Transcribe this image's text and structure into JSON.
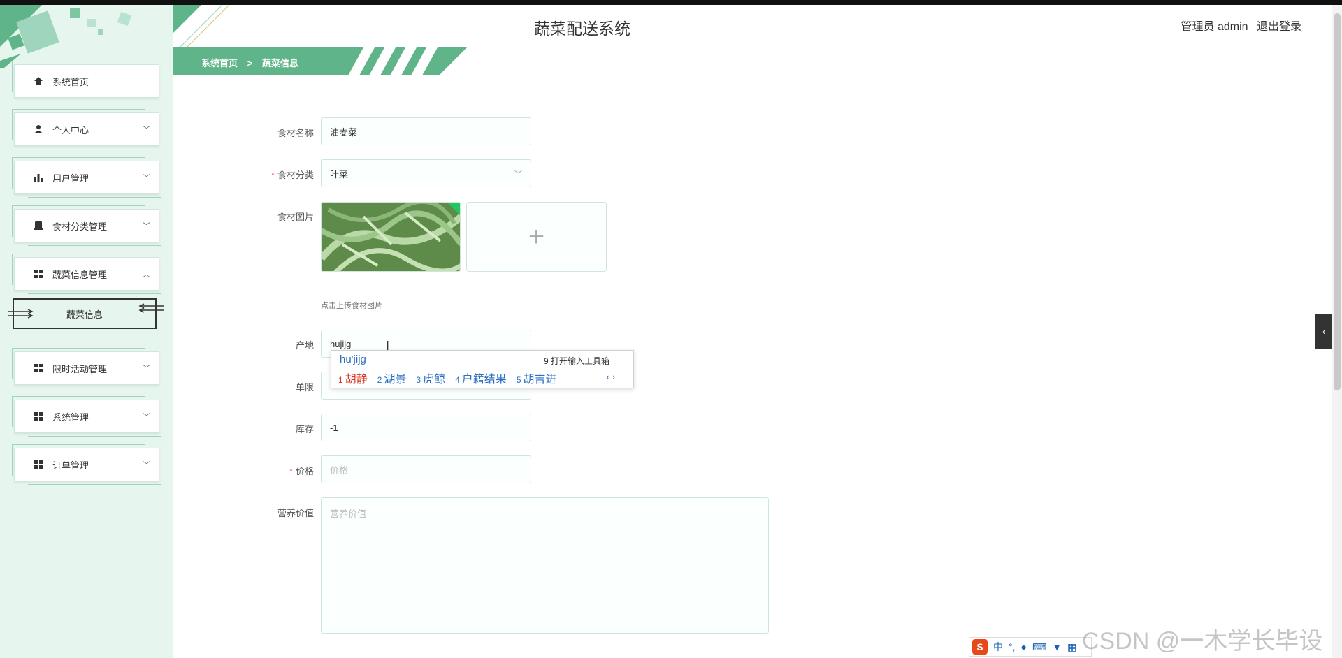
{
  "app": {
    "title": "蔬菜配送系统",
    "user_label": "管理员 admin",
    "logout": "退出登录"
  },
  "breadcrumb": {
    "home": "系统首页",
    "separator": ">",
    "current": "蔬菜信息"
  },
  "sidebar": {
    "items": [
      {
        "label": "系统首页",
        "icon": "home-icon"
      },
      {
        "label": "个人中心",
        "icon": "user-icon"
      },
      {
        "label": "用户管理",
        "icon": "bar-chart-icon"
      },
      {
        "label": "食材分类管理",
        "icon": "category-icon"
      },
      {
        "label": "蔬菜信息管理",
        "icon": "grid-icon"
      },
      {
        "label": "限时活动管理",
        "icon": "grid-icon"
      },
      {
        "label": "系统管理",
        "icon": "grid-icon"
      },
      {
        "label": "订单管理",
        "icon": "grid-icon"
      }
    ],
    "submenu": {
      "label": "蔬菜信息"
    }
  },
  "form": {
    "name": {
      "label": "食材名称",
      "value": "油麦菜"
    },
    "category": {
      "label": "食材分类",
      "value": "叶菜"
    },
    "image": {
      "label": "食材图片",
      "upload_tip": "点击上传食材图片",
      "plus": "+"
    },
    "origin": {
      "label": "产地",
      "value": "hujijg"
    },
    "limit": {
      "label": "单限",
      "value": ""
    },
    "stock": {
      "label": "库存",
      "value": "-1"
    },
    "price": {
      "label": "价格",
      "placeholder": "价格"
    },
    "nutrition": {
      "label": "营养价值",
      "placeholder": "营养价值"
    },
    "required_mark": "*"
  },
  "ime": {
    "composition": "hu'jijg",
    "tools": "9 打开输入工具箱",
    "candidates": [
      {
        "num": "1",
        "text": "胡静"
      },
      {
        "num": "2",
        "text": "湖景"
      },
      {
        "num": "3",
        "text": "虎鲸"
      },
      {
        "num": "4",
        "text": "户籍结果"
      },
      {
        "num": "5",
        "text": "胡吉进"
      }
    ],
    "nav": "‹ ›"
  },
  "tray": {
    "logo": "S",
    "mode": "中"
  },
  "watermark": "CSDN @一木学长毕设",
  "colors": {
    "accent": "#5fb48a",
    "sidebar_bg": "#e6f6ef",
    "border": "#cfe6dc"
  }
}
